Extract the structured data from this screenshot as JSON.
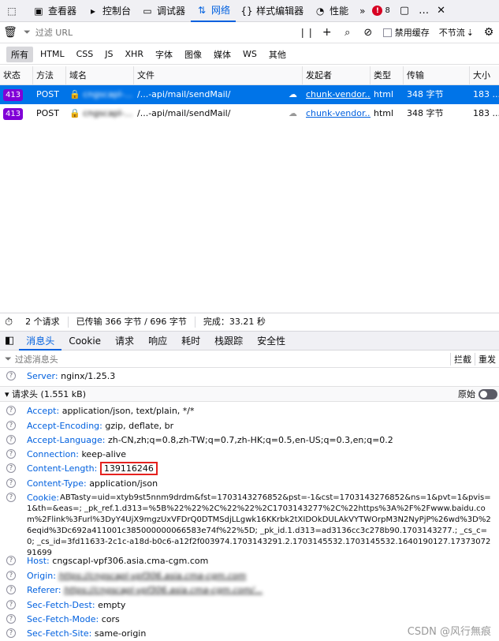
{
  "toolbar": {
    "tabs": [
      {
        "label": "查看器",
        "icon": "inspector-icon"
      },
      {
        "label": "控制台",
        "icon": "console-icon"
      },
      {
        "label": "调试器",
        "icon": "debugger-icon"
      },
      {
        "label": "网络",
        "icon": "network-icon"
      },
      {
        "label": "样式编辑器",
        "icon": "style-editor-icon"
      },
      {
        "label": "性能",
        "icon": "performance-icon"
      }
    ],
    "error_count": "8"
  },
  "filter": {
    "placeholder": "过滤 URL",
    "disable_cache": "禁用缓存",
    "throttle": "不节流"
  },
  "types": [
    "所有",
    "HTML",
    "CSS",
    "JS",
    "XHR",
    "字体",
    "图像",
    "媒体",
    "WS",
    "其他"
  ],
  "table": {
    "columns": [
      "状态",
      "方法",
      "域名",
      "文件",
      "发起者",
      "类型",
      "传输",
      "大小"
    ],
    "rows": [
      {
        "status": "413",
        "method": "POST",
        "domain": "cngscapl-...",
        "file": "/...-api/mail/sendMail/",
        "initiator": "chunk-vendor...",
        "type": "html",
        "transfer": "348 字节",
        "size": "183 ..."
      },
      {
        "status": "413",
        "method": "POST",
        "domain": "cngscapl-...",
        "file": "/...-api/mail/sendMail/",
        "initiator": "chunk-vendor...",
        "type": "html",
        "transfer": "348 字节",
        "size": "183 ..."
      }
    ]
  },
  "statusbar": {
    "requests": "2 个请求",
    "transferred": "已传输 366 字节 / 696 字节",
    "finish": "完成：33.21 秒"
  },
  "detail_tabs": [
    "消息头",
    "Cookie",
    "请求",
    "响应",
    "耗时",
    "栈跟踪",
    "安全性"
  ],
  "headers_filter": {
    "placeholder": "过滤消息头",
    "block": "拦截",
    "resend": "重发"
  },
  "server": {
    "key": "Server:",
    "value": "nginx/1.25.3"
  },
  "request_headers": {
    "title": "请求头 (1.551 kB)",
    "raw_label": "原始",
    "items": [
      {
        "key": "Accept:",
        "value": "application/json, text/plain, */*"
      },
      {
        "key": "Accept-Encoding:",
        "value": "gzip, deflate, br"
      },
      {
        "key": "Accept-Language:",
        "value": "zh-CN,zh;q=0.8,zh-TW;q=0.7,zh-HK;q=0.5,en-US;q=0.3,en;q=0.2"
      },
      {
        "key": "Connection:",
        "value": "keep-alive"
      },
      {
        "key": "Content-Length:",
        "value": "139116246"
      },
      {
        "key": "Content-Type:",
        "value": "application/json"
      }
    ],
    "cookie_key": "Cookie:",
    "cookie_value": "ABTasty=uid=xtyb9st5nnm9drdm&fst=1703143276852&pst=-1&cst=1703143276852&ns=1&pvt=1&pvis=1&th=&eas=; _pk_ref.1.d313=%5B%22%22%2C%22%22%2C1703143277%2C%22https%3A%2F%2Fwww.baidu.com%2Flink%3Furl%3DyY4UjX9mgzUxVFDrQ0DTMSdjLLgwk16KKrbk2tXIDOkDULAkVYTWOrpM3N2NyPjP%26wd%3D%26eqid%3Dc692a411001c385000000066583e74f%22%5D; _pk_id.1.d313=ad3136cc3c278b90.1703143277.; _cs_c=0; _cs_id=3fd11633-2c1c-a18d-b0c6-a12f2f003974.1703143291.2.1703145532.1703145532.1640190127.1737307291699",
    "items_after": [
      {
        "key": "Host:",
        "value": "cngscapl-vpf306.asia.cma-cgm.com"
      },
      {
        "key": "Origin:",
        "value": "https://cngscapl-vpf306.asia.cma-cgm.com"
      },
      {
        "key": "Referer:",
        "value": "https://cngscapl-vpf306.asia.cma-cgm.com/..."
      },
      {
        "key": "Sec-Fetch-Dest:",
        "value": "empty"
      },
      {
        "key": "Sec-Fetch-Mode:",
        "value": "cors"
      },
      {
        "key": "Sec-Fetch-Site:",
        "value": "same-origin"
      }
    ]
  },
  "watermark": "CSDN @风行無痕",
  "colors": {
    "accent": "#0060df",
    "selected_row": "#0074e8",
    "status_badge": "#8000d7",
    "highlight_box": "#e5211e"
  }
}
